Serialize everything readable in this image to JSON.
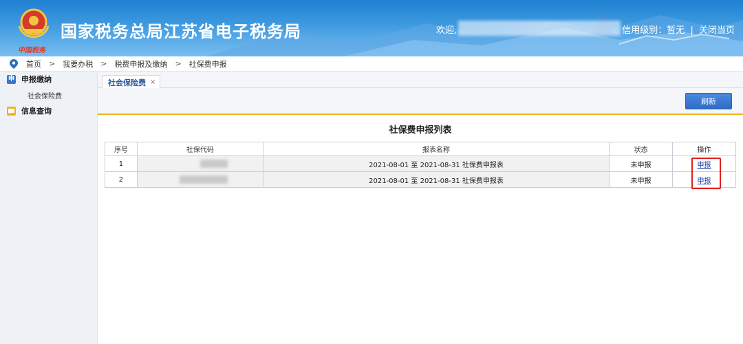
{
  "header": {
    "site_title": "国家税务总局江苏省电子税务局",
    "logo_caption": "中国税务",
    "welcome": "欢迎,",
    "credit_label": "信用级别：暂无",
    "separator": "|",
    "close_page": "关闭当页"
  },
  "breadcrumb": [
    "首页",
    "我要办税",
    "税费申报及缴纳",
    "社保费申报"
  ],
  "breadcrumb_sep": ">",
  "sidebar": {
    "sections": [
      {
        "label": "申报缴纳",
        "icon": "declare-icon",
        "icon_text": "申",
        "items": [
          "社会保险费"
        ]
      },
      {
        "label": "信息查询",
        "icon": "message-icon",
        "items": []
      }
    ]
  },
  "tabs": [
    {
      "label": "社会保险费",
      "close": "×"
    }
  ],
  "toolbar": {
    "refresh_label": "刷新"
  },
  "list": {
    "title": "社保费申报列表",
    "columns": [
      "序号",
      "社保代码",
      "报表名称",
      "状态",
      "操作"
    ],
    "rows": [
      {
        "index": "1",
        "report": "2021-08-01 至 2021-08-31  社保费申报表",
        "status": "未申报",
        "action": "申报"
      },
      {
        "index": "2",
        "report": "2021-08-01 至 2021-08-31  社保费申报表",
        "status": "未申报",
        "action": "申报"
      }
    ]
  },
  "colors": {
    "header_blue": "#2f87d6",
    "accent_yellow": "#f0b21b",
    "button_blue": "#3a78d2",
    "highlight_red": "#e02020",
    "link_blue": "#1a3fb0"
  }
}
